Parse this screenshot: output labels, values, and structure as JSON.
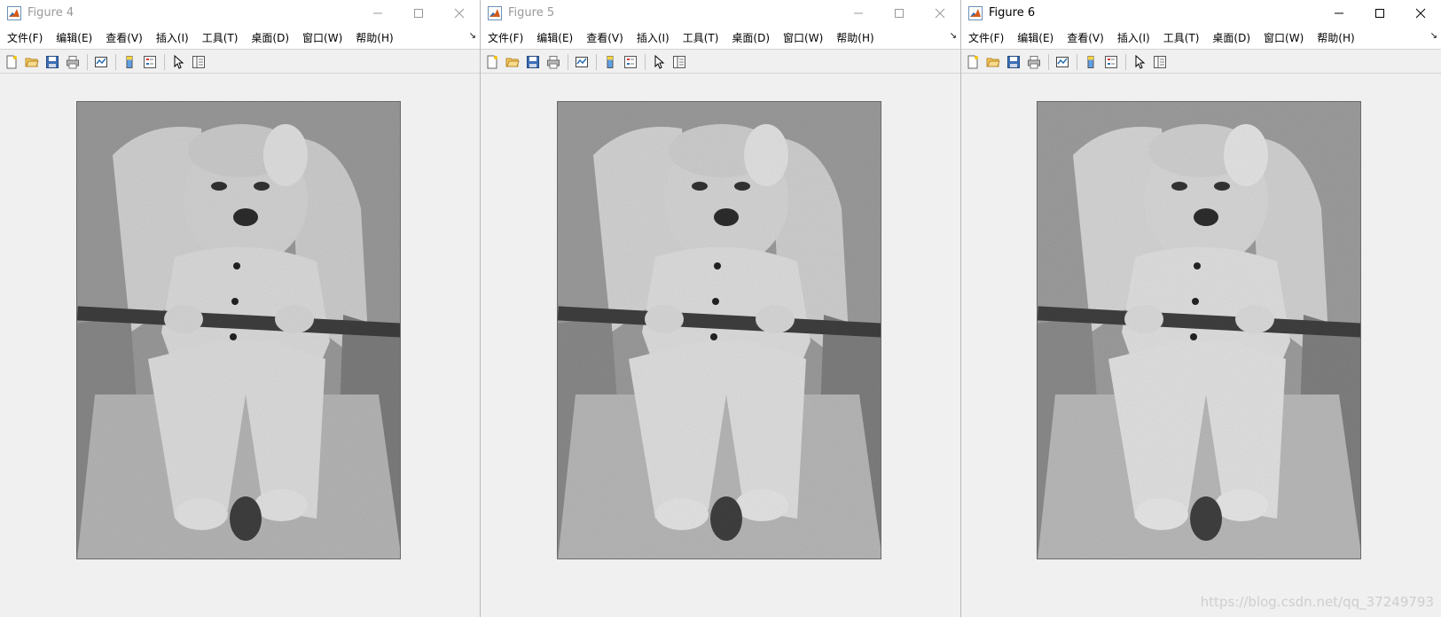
{
  "windows": [
    {
      "title": "Figure 4",
      "active": false
    },
    {
      "title": "Figure 5",
      "active": false
    },
    {
      "title": "Figure 6",
      "active": true
    }
  ],
  "menu": {
    "items": [
      "文件(F)",
      "编辑(E)",
      "查看(V)",
      "插入(I)",
      "工具(T)",
      "桌面(D)",
      "窗口(W)",
      "帮助(H)"
    ],
    "overflow": "↘"
  },
  "toolbar": {
    "icons": [
      "new-figure-icon",
      "open-file-icon",
      "save-icon",
      "print-icon",
      "link-plot-icon",
      "insert-colorbar-icon",
      "insert-legend-icon",
      "pointer-icon",
      "property-inspector-icon"
    ]
  },
  "figure": {
    "image_description_icon": "grayscale-photo-baby-in-chair"
  },
  "watermark": "https://blog.csdn.net/qq_37249793",
  "colors": {
    "window_bg": "#f0f0f0",
    "titlebar_bg": "#ffffff",
    "inactive_title": "#999999",
    "active_title": "#000000"
  }
}
